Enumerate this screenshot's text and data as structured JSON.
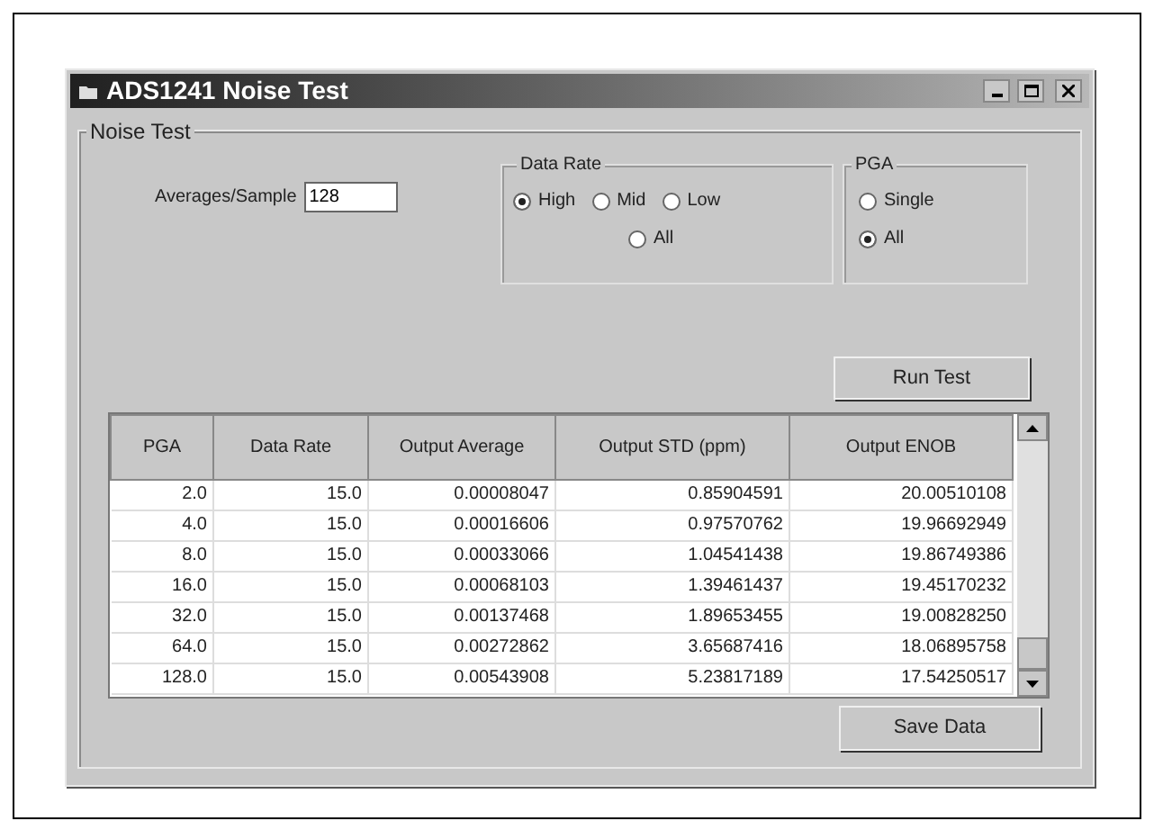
{
  "window": {
    "title": "ADS1241 Noise Test"
  },
  "group": {
    "title": "Noise Test"
  },
  "averages": {
    "label": "Averages/Sample",
    "value": "128"
  },
  "data_rate": {
    "title": "Data Rate",
    "options": [
      {
        "label": "High",
        "selected": true
      },
      {
        "label": "Mid",
        "selected": false
      },
      {
        "label": "Low",
        "selected": false
      },
      {
        "label": "All",
        "selected": false
      }
    ]
  },
  "pga": {
    "title": "PGA",
    "options": [
      {
        "label": "Single",
        "selected": false
      },
      {
        "label": "All",
        "selected": true
      }
    ]
  },
  "run_button": "Run Test",
  "table": {
    "columns": [
      "PGA",
      "Data Rate",
      "Output Average",
      "Output STD (ppm)",
      "Output ENOB"
    ],
    "rows": [
      [
        "2.0",
        "15.0",
        "0.00008047",
        "0.85904591",
        "20.00510108"
      ],
      [
        "4.0",
        "15.0",
        "0.00016606",
        "0.97570762",
        "19.96692949"
      ],
      [
        "8.0",
        "15.0",
        "0.00033066",
        "1.04541438",
        "19.86749386"
      ],
      [
        "16.0",
        "15.0",
        "0.00068103",
        "1.39461437",
        "19.45170232"
      ],
      [
        "32.0",
        "15.0",
        "0.00137468",
        "1.89653455",
        "19.00828250"
      ],
      [
        "64.0",
        "15.0",
        "0.00272862",
        "3.65687416",
        "18.06895758"
      ],
      [
        "128.0",
        "15.0",
        "0.00543908",
        "5.23817189",
        "17.54250517"
      ]
    ]
  },
  "save_button": "Save Data"
}
